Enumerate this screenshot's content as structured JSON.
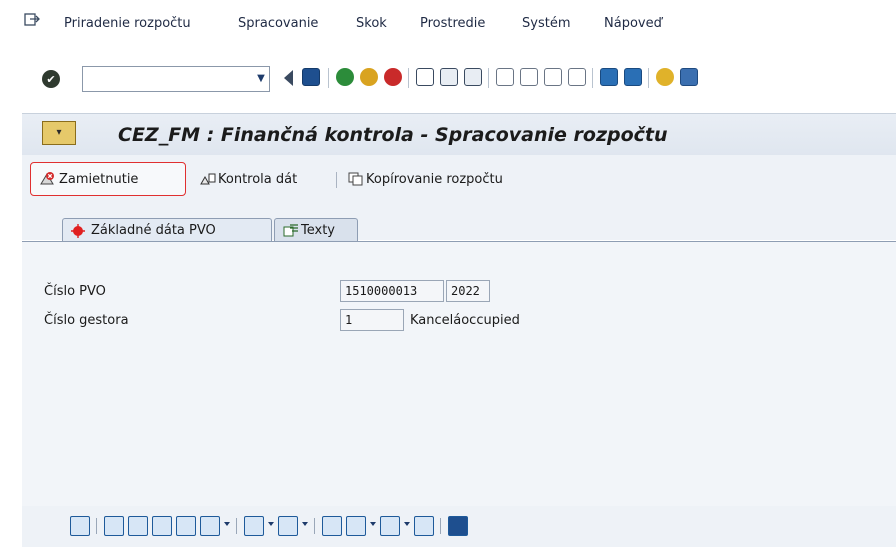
{
  "menu": {
    "items": [
      "Priradenie rozpočtu",
      "Spracovanie",
      "Skok",
      "Prostredie",
      "Systém",
      "Nápoveď"
    ]
  },
  "title": "CEZ_FM : Finančná kontrola - Spracovanie rozpočtu",
  "toolbar": {
    "reject_label": "Zamietnutie",
    "check_label": "Kontrola dát",
    "copy_label": "Kopírovanie rozpočtu"
  },
  "tabs": [
    {
      "label": "Základné dáta PVO"
    },
    {
      "label": "Texty"
    }
  ],
  "form": {
    "pvo_number_label": "Číslo PVO",
    "pvo_number": "1510000013",
    "pvo_year": "2022",
    "gestor_label": "Číslo gestora",
    "gestor_number": "1",
    "gestor_name": "Kanceláoccupied"
  },
  "colors": {
    "reject_border": "#e03030",
    "accent": "#1e5a9a"
  }
}
